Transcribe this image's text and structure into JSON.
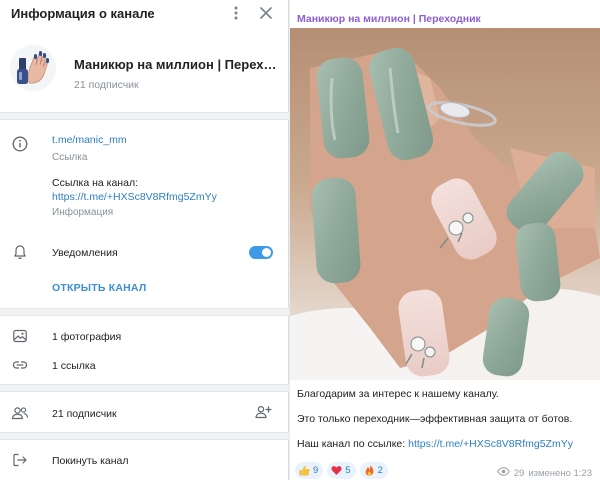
{
  "panel": {
    "title": "Информация о канале",
    "channel_name": "Маникюр на миллион | Перех…",
    "subscribers_line": "21 подписчик",
    "link": "t.me/manic_mm",
    "link_caption": "Ссылка",
    "invite_heading": "Ссылка на канал:",
    "invite_link": "https://t.me/+HXSc8V8Rfmg5ZmYy",
    "invite_caption": "Информация",
    "notifications_label": "Уведомления",
    "notifications_on": true,
    "open_channel": "ОТКРЫТЬ КАНАЛ",
    "media_photos": "1 фотография",
    "media_links": "1 ссылка",
    "members": "21 подписчик",
    "leave": "Покинуть канал"
  },
  "message": {
    "sender": "Маникюр на миллион | Переходник",
    "line1": "Благодарим за интерес к нашему каналу.",
    "line2": "Это только переходник—эффективная защита от ботов.",
    "line3_prefix": "Наш канал по ссылке:",
    "line3_link": "https://t.me/+HXSc8V8Rfmg5ZmYy",
    "reactions": [
      {
        "emoji": "thumbs-up",
        "count": "9"
      },
      {
        "emoji": "heart",
        "count": "5"
      },
      {
        "emoji": "fire",
        "count": "2"
      }
    ],
    "views": "29",
    "edited": "изменено 1:23"
  },
  "colors": {
    "accent": "#3f9be5",
    "link": "#2b7fc7",
    "sender": "#8e5fcc",
    "nail_green": "#8fa99a"
  }
}
